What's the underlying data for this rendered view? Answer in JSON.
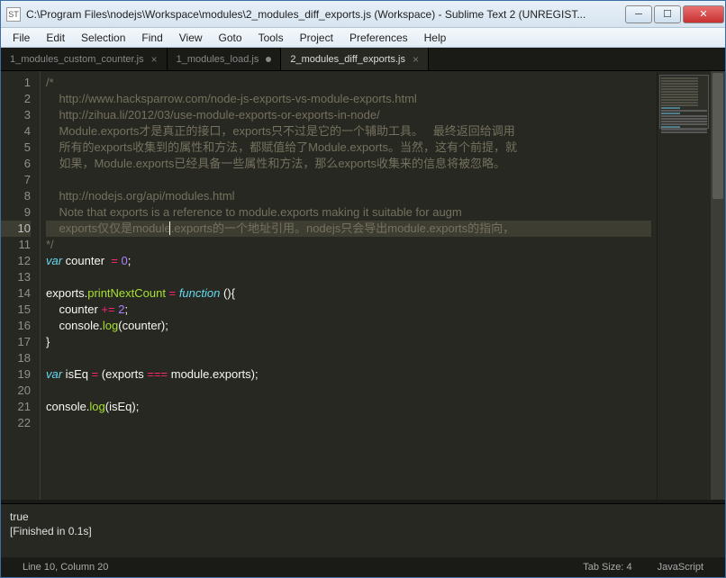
{
  "window": {
    "title": "C:\\Program Files\\nodejs\\Workspace\\modules\\2_modules_diff_exports.js (Workspace) - Sublime Text 2 (UNREGIST...",
    "icon_label": "ST"
  },
  "menu": {
    "items": [
      "File",
      "Edit",
      "Selection",
      "Find",
      "View",
      "Goto",
      "Tools",
      "Project",
      "Preferences",
      "Help"
    ]
  },
  "tabs": [
    {
      "label": "1_modules_custom_counter.js",
      "active": false,
      "dirty": false
    },
    {
      "label": "1_modules_load.js",
      "active": false,
      "dirty": true
    },
    {
      "label": "2_modules_diff_exports.js",
      "active": true,
      "dirty": false
    }
  ],
  "code": {
    "highlight_line": 10,
    "caret_col": 20,
    "lines": [
      {
        "n": 1,
        "segs": [
          {
            "c": "comment",
            "t": "/*"
          }
        ]
      },
      {
        "n": 2,
        "segs": [
          {
            "c": "comment",
            "t": "    http://www.hacksparrow.com/node-js-exports-vs-module-exports.html"
          }
        ]
      },
      {
        "n": 3,
        "segs": [
          {
            "c": "comment",
            "t": "    http://zihua.li/2012/03/use-module-exports-or-exports-in-node/"
          }
        ]
      },
      {
        "n": 4,
        "segs": [
          {
            "c": "comment",
            "t": "    Module.exports才是真正的接口，exports只不过是它的一个辅助工具。   最终返回给调用"
          }
        ]
      },
      {
        "n": 5,
        "segs": [
          {
            "c": "comment",
            "t": "    所有的exports收集到的属性和方法，都赋值给了Module.exports。当然，这有个前提，就"
          }
        ]
      },
      {
        "n": 6,
        "segs": [
          {
            "c": "comment",
            "t": "    如果，Module.exports已经具备一些属性和方法，那么exports收集来的信息将被忽略。"
          }
        ]
      },
      {
        "n": 7,
        "segs": [
          {
            "c": "comment",
            "t": ""
          }
        ]
      },
      {
        "n": 8,
        "segs": [
          {
            "c": "comment",
            "t": "    http://nodejs.org/api/modules.html"
          }
        ]
      },
      {
        "n": 9,
        "segs": [
          {
            "c": "comment",
            "t": "    Note that exports is a reference to module.exports making it suitable for augm"
          }
        ]
      },
      {
        "n": 10,
        "segs": [
          {
            "c": "comment",
            "t": "    exports仅仅是module.exports的一个地址引用。nodejs只会导出module.exports的指向，"
          }
        ]
      },
      {
        "n": 11,
        "segs": [
          {
            "c": "comment",
            "t": "*/"
          }
        ]
      },
      {
        "n": 12,
        "segs": [
          {
            "c": "kw",
            "t": "var"
          },
          {
            "c": "fn",
            "t": " counter  "
          },
          {
            "c": "op",
            "t": "="
          },
          {
            "c": "fn",
            "t": " "
          },
          {
            "c": "num",
            "t": "0"
          },
          {
            "c": "fn",
            "t": ";"
          }
        ]
      },
      {
        "n": 13,
        "segs": []
      },
      {
        "n": 14,
        "segs": [
          {
            "c": "fn",
            "t": "exports."
          },
          {
            "c": "name",
            "t": "printNextCount"
          },
          {
            "c": "fn",
            "t": " "
          },
          {
            "c": "op",
            "t": "="
          },
          {
            "c": "fn",
            "t": " "
          },
          {
            "c": "kw",
            "t": "function"
          },
          {
            "c": "fn",
            "t": " (){"
          }
        ]
      },
      {
        "n": 15,
        "segs": [
          {
            "c": "fn",
            "t": "    counter "
          },
          {
            "c": "op",
            "t": "+="
          },
          {
            "c": "fn",
            "t": " "
          },
          {
            "c": "num",
            "t": "2"
          },
          {
            "c": "fn",
            "t": ";"
          }
        ]
      },
      {
        "n": 16,
        "segs": [
          {
            "c": "fn",
            "t": "    console."
          },
          {
            "c": "name",
            "t": "log"
          },
          {
            "c": "fn",
            "t": "(counter);"
          }
        ]
      },
      {
        "n": 17,
        "segs": [
          {
            "c": "fn",
            "t": "}"
          }
        ]
      },
      {
        "n": 18,
        "segs": []
      },
      {
        "n": 19,
        "segs": [
          {
            "c": "kw",
            "t": "var"
          },
          {
            "c": "fn",
            "t": " isEq "
          },
          {
            "c": "op",
            "t": "="
          },
          {
            "c": "fn",
            "t": " (exports "
          },
          {
            "c": "op",
            "t": "==="
          },
          {
            "c": "fn",
            "t": " module.exports);"
          }
        ]
      },
      {
        "n": 20,
        "segs": []
      },
      {
        "n": 21,
        "segs": [
          {
            "c": "fn",
            "t": "console."
          },
          {
            "c": "name",
            "t": "log"
          },
          {
            "c": "fn",
            "t": "(isEq);"
          }
        ]
      },
      {
        "n": 22,
        "segs": []
      }
    ]
  },
  "console": {
    "lines": [
      "true",
      "[Finished in 0.1s]"
    ]
  },
  "status": {
    "position": "Line 10, Column 20",
    "tab_size": "Tab Size: 4",
    "syntax": "JavaScript"
  }
}
